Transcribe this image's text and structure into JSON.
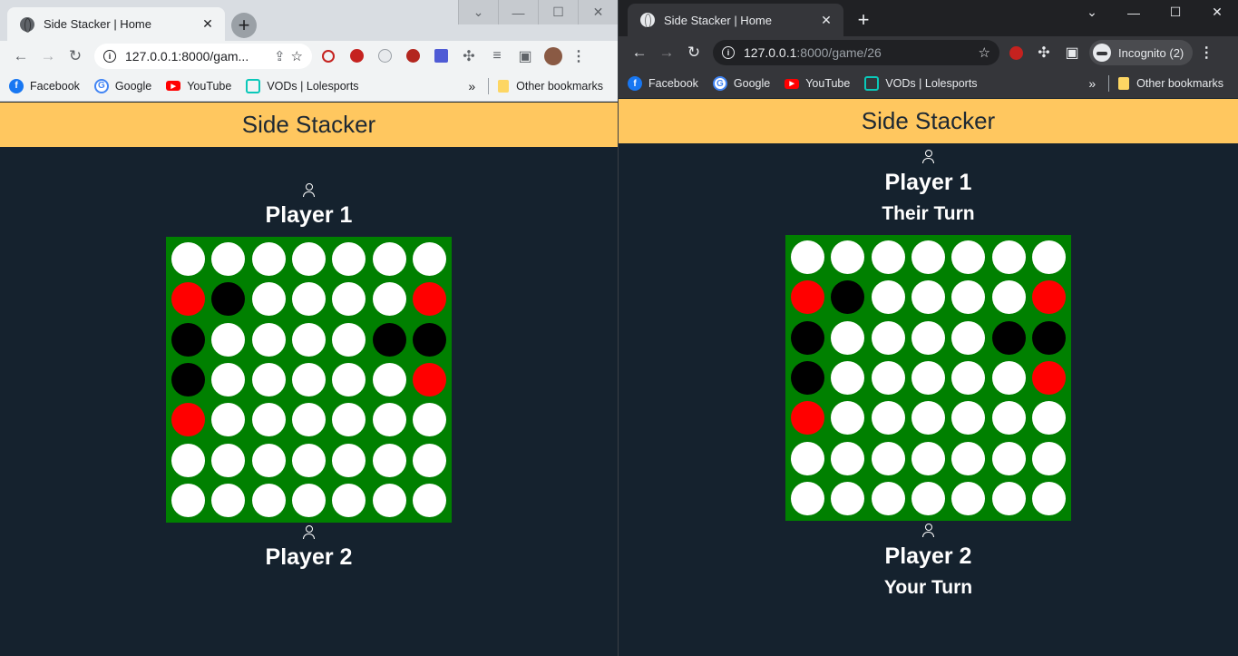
{
  "left_window": {
    "tab_title": "Side Stacker | Home",
    "url_host": "127.0.0.1:8000/gam...",
    "url_path": "",
    "bookmarks": [
      "Facebook",
      "Google",
      "YouTube",
      "VODs | Lolesports"
    ],
    "other_bookmarks": "Other bookmarks",
    "page": {
      "header": "Side Stacker",
      "top_player": {
        "name": "Player 1",
        "status": ""
      },
      "bottom_player": {
        "name": "Player 2",
        "status": ""
      }
    }
  },
  "right_window": {
    "tab_title": "Side Stacker | Home",
    "url_host": "127.0.0.1",
    "url_path": ":8000/game/26",
    "incognito_label": "Incognito (2)",
    "bookmarks": [
      "Facebook",
      "Google",
      "YouTube",
      "VODs | Lolesports"
    ],
    "other_bookmarks": "Other bookmarks",
    "page": {
      "header": "Side Stacker",
      "top_player": {
        "name": "Player 1",
        "status": "Their Turn"
      },
      "bottom_player": {
        "name": "Player 2",
        "status": "Your Turn"
      }
    }
  },
  "board": {
    "legend": {
      "w": "empty",
      "r": "red",
      "b": "black"
    },
    "colors": {
      "board": "#008000",
      "empty": "#ffffff",
      "red": "#ff0000",
      "black": "#000000"
    },
    "rows": [
      [
        "w",
        "w",
        "w",
        "w",
        "w",
        "w",
        "w"
      ],
      [
        "r",
        "b",
        "w",
        "w",
        "w",
        "w",
        "r"
      ],
      [
        "b",
        "w",
        "w",
        "w",
        "w",
        "b",
        "b"
      ],
      [
        "b",
        "w",
        "w",
        "w",
        "w",
        "w",
        "r"
      ],
      [
        "r",
        "w",
        "w",
        "w",
        "w",
        "w",
        "w"
      ],
      [
        "w",
        "w",
        "w",
        "w",
        "w",
        "w",
        "w"
      ],
      [
        "w",
        "w",
        "w",
        "w",
        "w",
        "w",
        "w"
      ]
    ]
  },
  "theme": {
    "header_bg": "#ffc75f",
    "page_bg": "#15222e"
  }
}
